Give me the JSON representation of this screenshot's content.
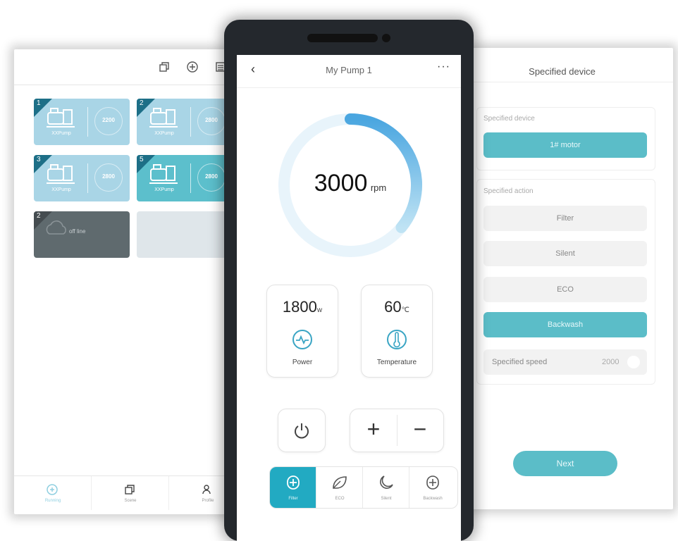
{
  "left": {
    "tiles": [
      {
        "num": "1",
        "name": "XXPump",
        "value": "2200"
      },
      {
        "num": "2",
        "name": "XXPump",
        "value": "2800"
      },
      {
        "num": "3",
        "name": "XXPump",
        "value": "2800"
      },
      {
        "num": "5",
        "name": "XXPump",
        "value": "2800"
      },
      {
        "num": "2",
        "offline": "off line"
      }
    ],
    "nav": [
      "Running",
      "Scene",
      "Profile"
    ]
  },
  "phone": {
    "title": "My Pump 1",
    "speed_value": "3000",
    "speed_unit": "rpm",
    "speed_level": 0.36,
    "power_value": "1800",
    "power_unit": "w",
    "power_label": "Power",
    "temp_value": "60",
    "temp_unit": "℃",
    "temp_label": "Temperature",
    "plus": "+",
    "minus": "−",
    "modes": [
      "Filter",
      "ECO",
      "Silent",
      "Backwash"
    ]
  },
  "right": {
    "title": "Specified device",
    "device_label": "Specified device",
    "device_value": "1# motor",
    "action_label": "Specified action",
    "actions": [
      "Filter",
      "Silent",
      "ECO",
      "Backwash"
    ],
    "selected_action": "Backwash",
    "speed_label": "Specified speed",
    "speed_value": "2000",
    "next_label": "Next"
  },
  "colors": {
    "accent": "#5bbdc8",
    "accent_dark": "#22aac2",
    "tile_light": "#a9d5e6",
    "tile_teal": "#5cbfcc",
    "offline": "#5f6a6e"
  }
}
